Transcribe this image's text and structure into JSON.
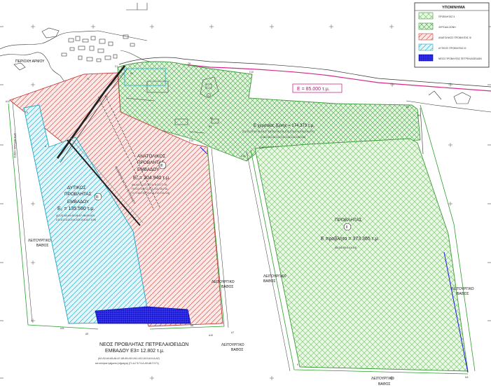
{
  "legend": {
    "title": "ΥΠΟΜΝΗΜΑ",
    "items": [
      {
        "color": "#7dc86a",
        "hatch": "cross",
        "label": "ΠΡΟΒΛΗΤΑΣ ΙΙ"
      },
      {
        "color": "#3fb23f",
        "hatch": "cross",
        "label": "ΧΕΡΣΑΙΑ ΖΩΝΗ"
      },
      {
        "color": "#d9534f",
        "hatch": "diag",
        "label": "ΑΝΑΤΟΛΙΚΟΣ ΠΡΟΒΛΗΤΑΣ ΙΙΙ"
      },
      {
        "color": "#2ab7d6",
        "hatch": "diag",
        "label": "ΔΥΤΙΚΟΣ ΠΡΟΒΛΗΤΑΣ ΙΙΙ"
      },
      {
        "color": "#1a1ad8",
        "hatch": "grid",
        "label": "ΝΕΟΣ ΠΡΟΒΛΗΤΑΣ ΠΕΤΡΕΛΑΙΟΕΙΔΩΝ"
      }
    ]
  },
  "labels": {
    "area_armou": "ΠΕΡΙΟΧΗ ΑΡΜΟΥ",
    "e_top": "E = 85.000 τ.μ.",
    "xersaia": "E χερσαίας ζώνης = 174.373 τ.μ.",
    "xersaia_codes": "(Σ1-Σ2-Σ3-Σ4-Σ5-Σ6-Σ7-Σ8-Σ9-Σ10-Σ11-Σ12-Σ13-Σ14-Σ15-Σ16-Σ17)",
    "xersaia_codes2": "(Σ18-Σ19-Σ20-Σ21-Σ22-Σ23-Σ24-Σ25-Σ26)",
    "anatolikos_1": "ΑΝΑΤΟΛΙΚΟΣ",
    "anatolikos_2": "ΠΡΟΒΛΗΤΑΣ",
    "anatolikos_3": "ΕΜΒΑΔΟΥ",
    "roman_iii": "III",
    "anatolikos_area": "E₁ = 204.940 τ.μ.",
    "anatolikos_codes": "(Α1-Α2-Γ1-Γ2-Γ3-Γ4-Γ5-Γ6-Γ7-Γ8-",
    "anatolikos_codes2": "Γ9-Γ10-Γ11-Γ12-Γ13-Γ14-Γ15-Γ16-",
    "anatolikos_codes3": "Γ17-Γ18-Γ19-Γ20-Γ21-Γ22-Γ23-Γ24)",
    "dytikos_1": "ΔΥΤΙΚΟΣ",
    "dytikos_2": "ΠΡΟΒΛΗΤΑΣ",
    "dytikos_3": "ΕΜΒΑΔΟΥ",
    "dytikos_area": "E₂ = 135.590 τ.μ.",
    "dytikos_codes": "(Δ1-Δ2-Δ3-Δ4-Δ5-Δ6-Δ7-Δ8-Δ9-Δ10-",
    "dytikos_codes2": "Δ11-Δ12-Δ13-Δ14-Δ15-Δ16-Δ17-Δ18)",
    "problitas": "ΠΡΟΒΛΗΤΑΣ",
    "roman_ii": "II",
    "problitas_area": "E προβλήτα = 373.365 τ.μ.",
    "problitas_codes": "(Β2-Β4-Β5-Κ-ΚΑ-Κ3)",
    "leitourgiko": "ΛΕΙΤΟΥΡΓΙΚΟ",
    "vathos": "ΒΑΘΟΣ",
    "neos_1": "ΝΕΟΣ ΠΡΟΒΛΗΤΑΣ ΠΕΤΡΕΛΑΙΟΕΙΔΩΝ",
    "neos_2": "ΕΜΒΑΔΟΥ  E3= 12.802 τ.μ.",
    "neos_codes": "(Δ2-Δ3-Δ4-Δ5-Δ6-Δ7-Δ8-Δ9-Δ10-Δ11-Δ12-Δ13-Δ14-Α-Δ2)",
    "neos_codes2": "και υπόγεια τμήματα (σήραγγα) (Γ1-Δ-Γ3-Γ4-Α-Δ9-Δ8-Γ2-Γ1)",
    "leoforos": "ΛΕΩΦΟΡΟΣ ΑΚΤΗΣ ΠΕΤΡΕΛΑΙΟΥ",
    "oria": "ΟΡΙΑ ΧΕΡΣΑΙΑΣ ΖΩΝΗΣ",
    "points": [
      "Δ12",
      "Δ11",
      "Δ9",
      "Δ10",
      "Δ7",
      "Δ8",
      "Γ9",
      "Γ1",
      "Γ2",
      "Α",
      "Β1",
      "Β2",
      "Β3",
      "Β4",
      "Β5",
      "Κ",
      "ΚΑ",
      "Σ1",
      "Σ8",
      "Σ10",
      "Σ14",
      "Σ15",
      "Σ16"
    ]
  }
}
